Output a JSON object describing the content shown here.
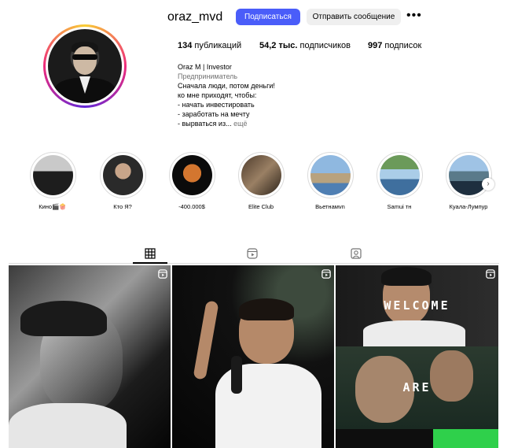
{
  "profile": {
    "username": "oraz_mvd",
    "follow_label": "Подписаться",
    "message_label": "Отправить сообщение",
    "more_label": "•••",
    "stats": {
      "posts_count": "134",
      "posts_label": "публикаций",
      "followers_count": "54,2 тыс.",
      "followers_label": "подписчиков",
      "following_count": "997",
      "following_label": "подписок"
    },
    "bio": {
      "name": "Oraz M | Investor",
      "category": "Предприниматель",
      "lines": [
        "Сначала люди, потом деньги!",
        "ко мне приходят, чтобы:",
        "- начать инвестировать",
        "- заработать на мечту",
        "- вырваться из..."
      ],
      "more": "ещё"
    }
  },
  "highlights": [
    {
      "label": "Кино🎬🍿"
    },
    {
      "label": "Кто Я?"
    },
    {
      "label": "-400.000$"
    },
    {
      "label": "Elite Club"
    },
    {
      "label": "Вьетнамvn"
    },
    {
      "label": "Samui тн"
    },
    {
      "label": "Куала-Лумпур"
    }
  ],
  "posts": [
    {
      "type": "reel",
      "overlay": []
    },
    {
      "type": "reel",
      "overlay": []
    },
    {
      "type": "reel",
      "overlay": [
        "WELCOME",
        "ARE"
      ]
    }
  ],
  "colors": {
    "follow_button": "#4a5df9",
    "secondary_button": "#efefef",
    "muted_text": "#737373"
  }
}
